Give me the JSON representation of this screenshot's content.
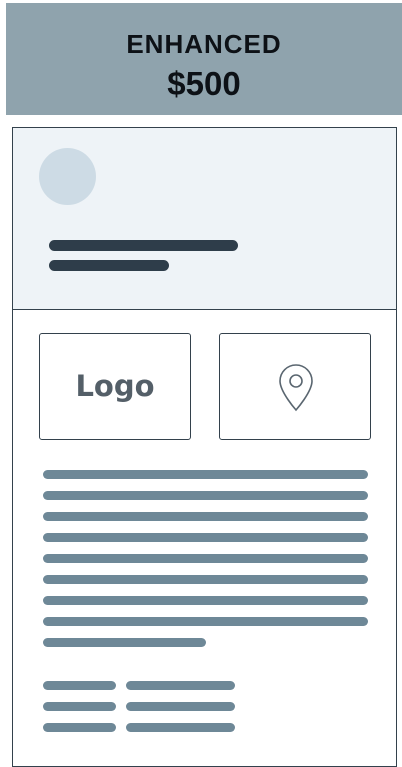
{
  "header": {
    "tier": "ENHANCED",
    "price": "$500",
    "background": "#8fa3ad"
  },
  "card": {
    "logo_label": "Logo",
    "map_icon": "location-pin-icon",
    "header_background": "#eef3f7",
    "placeholder_color": "#6e8897"
  }
}
